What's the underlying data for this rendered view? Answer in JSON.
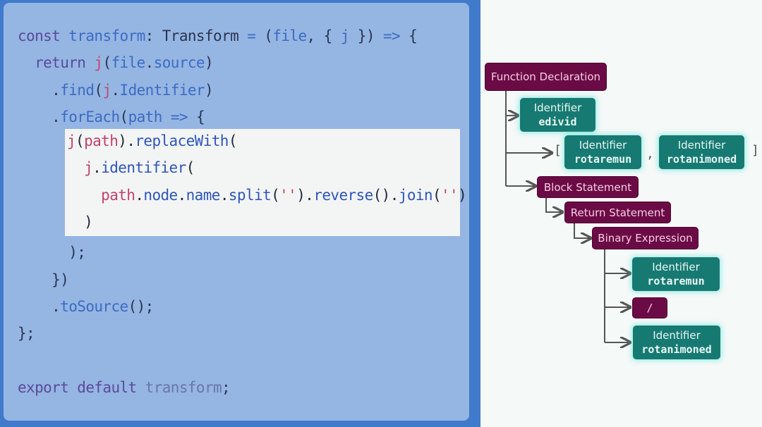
{
  "code": {
    "lines": [
      [
        {
          "c": "kw",
          "t": "const "
        },
        {
          "c": "fn",
          "t": "transform"
        },
        {
          "c": "pn",
          "t": ": Transform "
        },
        {
          "c": "op",
          "t": "="
        },
        {
          "c": "pn",
          "t": " ("
        },
        {
          "c": "fn",
          "t": "file"
        },
        {
          "c": "pn",
          "t": ", { "
        },
        {
          "c": "fn",
          "t": "j"
        },
        {
          "c": "pn",
          "t": " }) "
        },
        {
          "c": "op",
          "t": "=>"
        },
        {
          "c": "pn",
          "t": " {"
        }
      ],
      [
        {
          "c": "kw",
          "t": "  return "
        },
        {
          "c": "vr",
          "t": "j"
        },
        {
          "c": "pn",
          "t": "("
        },
        {
          "c": "fn",
          "t": "file"
        },
        {
          "c": "pn",
          "t": "."
        },
        {
          "c": "fn",
          "t": "source"
        },
        {
          "c": "pn",
          "t": ")"
        }
      ],
      [
        {
          "c": "pn",
          "t": "    ."
        },
        {
          "c": "fn",
          "t": "find"
        },
        {
          "c": "pn",
          "t": "("
        },
        {
          "c": "vr",
          "t": "j"
        },
        {
          "c": "pn",
          "t": "."
        },
        {
          "c": "fn",
          "t": "Identifier"
        },
        {
          "c": "pn",
          "t": ")"
        }
      ],
      [
        {
          "c": "pn",
          "t": "    ."
        },
        {
          "c": "fn",
          "t": "forEach"
        },
        {
          "c": "pn",
          "t": "("
        },
        {
          "c": "fn",
          "t": "path"
        },
        {
          "c": "op",
          "t": " =>"
        },
        {
          "c": "pn",
          "t": " {"
        }
      ],
      [
        {
          "c": "pn",
          "t": "      );"
        }
      ],
      [
        {
          "c": "pn",
          "t": "    })"
        }
      ],
      [
        {
          "c": "pn",
          "t": "    ."
        },
        {
          "c": "fn",
          "t": "toSource"
        },
        {
          "c": "pn",
          "t": "();"
        }
      ],
      [
        {
          "c": "pn",
          "t": "};"
        }
      ],
      [
        {
          "c": "pn",
          "t": ""
        }
      ],
      [
        {
          "c": "kw",
          "t": "export default "
        },
        {
          "c": "mu",
          "t": "transform"
        },
        {
          "c": "pn",
          "t": ";"
        }
      ]
    ],
    "highlighted_lines": [
      [
        {
          "c": "vr",
          "t": "j"
        },
        {
          "c": "pn",
          "t": "("
        },
        {
          "c": "vr",
          "t": "path"
        },
        {
          "c": "pn",
          "t": ")."
        },
        {
          "c": "fn",
          "t": "replaceWith"
        },
        {
          "c": "pn",
          "t": "("
        }
      ],
      [
        {
          "c": "vr",
          "t": "  j"
        },
        {
          "c": "pn",
          "t": "."
        },
        {
          "c": "fn",
          "t": "identifier"
        },
        {
          "c": "pn",
          "t": "("
        }
      ],
      [
        {
          "c": "vr",
          "t": "    path"
        },
        {
          "c": "pn",
          "t": "."
        },
        {
          "c": "fn",
          "t": "node"
        },
        {
          "c": "pn",
          "t": "."
        },
        {
          "c": "fn",
          "t": "name"
        },
        {
          "c": "pn",
          "t": "."
        },
        {
          "c": "fn",
          "t": "split"
        },
        {
          "c": "pn",
          "t": "("
        },
        {
          "c": "vr",
          "t": "''"
        },
        {
          "c": "pn",
          "t": ")."
        },
        {
          "c": "fn",
          "t": "reverse"
        },
        {
          "c": "pn",
          "t": "()."
        },
        {
          "c": "fn",
          "t": "join"
        },
        {
          "c": "pn",
          "t": "("
        },
        {
          "c": "vr",
          "t": "''"
        },
        {
          "c": "pn",
          "t": ")"
        }
      ],
      [
        {
          "c": "pn",
          "t": "  )"
        }
      ]
    ]
  },
  "ast": {
    "function_declaration": "Function Declaration",
    "id_node": {
      "type": "Identifier",
      "name": "edivid"
    },
    "params_open": "[",
    "params": [
      {
        "type": "Identifier",
        "name": "rotaremun"
      },
      {
        "type": "Identifier",
        "name": "rotanimoned"
      }
    ],
    "params_sep": ",",
    "params_close": "]",
    "block_statement": "Block Statement",
    "return_statement": "Return Statement",
    "binary_expression": "Binary Expression",
    "left": {
      "type": "Identifier",
      "name": "rotaremun"
    },
    "operator": "/",
    "right": {
      "type": "Identifier",
      "name": "rotanimoned"
    }
  },
  "colors": {
    "frame": "#3f7acb",
    "code_bg": "#95b5e3",
    "highlight_bg": "#f3f5f5",
    "maroon_node": "#6b0b45",
    "teal_node": "#177a72",
    "connector": "#555555"
  }
}
